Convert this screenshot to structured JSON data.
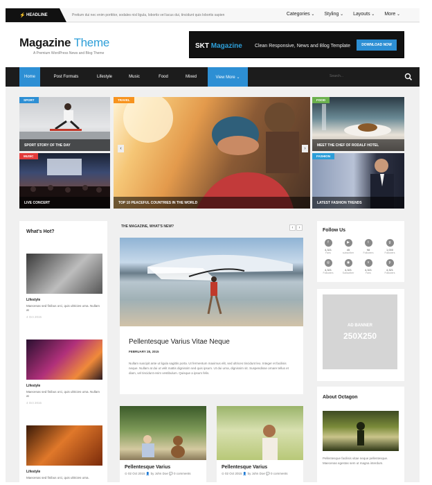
{
  "topbar": {
    "headline_label": "HEADLINE",
    "headline_text": "Pretium dui nec enim porttitor, sodales nisl ligula, lobortis vel lacus dui, tincidunt quis lobortis sapien",
    "menu": [
      "Categories",
      "Styling",
      "Layouts",
      "More"
    ]
  },
  "header": {
    "logo_main": "Magazine",
    "logo_accent": "Theme",
    "tagline": "A Premium WordPress News and Blog Theme",
    "banner_brand": "SKT",
    "banner_brand_accent": "Magazine",
    "banner_text": "Clean Responsive, News and Blog Template",
    "banner_button": "DOWNLOAD NOW"
  },
  "nav": {
    "items": [
      "Home",
      "Post Formats",
      "Lifestyle",
      "Music",
      "Food",
      "Mixed",
      "View More"
    ],
    "search_placeholder": "Search..."
  },
  "hero": {
    "tiles": [
      {
        "badge": "SPORT",
        "badge_color": "#2d8fd4",
        "caption": "SPORT STORY OF THE DAY"
      },
      {
        "badge": "MUSIC",
        "badge_color": "#e23b3b",
        "caption": "LIVE CONCERT"
      },
      {
        "badge": "TRAVEL",
        "badge_color": "#f7931e",
        "caption": "TOP 10 PEACEFUL COUNTRIES IN THE WORLD"
      },
      {
        "badge": "FOOD",
        "badge_color": "#6ab04c",
        "caption": "MEET THE CHEF OF RODALF HOTEL"
      },
      {
        "badge": "FASHION",
        "badge_color": "#2d9ed8",
        "caption": "LATEST FASHION TRENDS"
      }
    ]
  },
  "whats_hot": {
    "title": "What's Hot?",
    "posts": [
      {
        "category": "Lifestyle",
        "excerpt": "Maecenas sed finibus orci, quis ultricies urna. Nullam at",
        "date": "4 Oct 2015"
      },
      {
        "category": "Lifestyle",
        "excerpt": "Maecenas sed finibus orci, quis ultricies urna. Nullam at",
        "date": "4 Oct 2015"
      },
      {
        "category": "Lifestyle",
        "excerpt": "Maecenas sed finibus orci, quis ultricies urna.",
        "date": ""
      }
    ]
  },
  "main": {
    "section_title": "THE MAGAZINE, WHAT'S NEW?",
    "feature": {
      "title": "Pellentesque Varius Vitae Neque",
      "date": "FEBRUARY 28, 2015",
      "excerpt": "Nullam suscipit ante ut ligula sagittis porta. Ut fermentum maximus elit, sed ultrices tincidunt leo. Integer et facilisis neque. Nullam at dui ut velit mattis dignissim sed quis ipsum. Ut dui urna, dignissim sit. Suspendisse ornare tellus et diam, vel tincidunt enim vestibulum. Quisque a ipsum felis."
    },
    "small_posts": [
      {
        "title": "Pellentesque Varius",
        "meta": "⊙ 02 Oct 2015   👤 by John Doe   💬 0 comments"
      },
      {
        "title": "Pellentesque Varius",
        "meta": "⊙ 02 Oct 2015   👤 by John Doe   💬 0 comments"
      }
    ]
  },
  "follow": {
    "title": "Follow Us",
    "items": [
      {
        "n": "4,321",
        "l": "Fans"
      },
      {
        "n": "45",
        "l": "subscriber"
      },
      {
        "n": "98",
        "l": "Followers"
      },
      {
        "n": "1,000",
        "l": "Followers"
      },
      {
        "n": "4,321",
        "l": "Followers"
      },
      {
        "n": "4,321",
        "l": "Subscriber"
      },
      {
        "n": "4,321",
        "l": "Fans"
      },
      {
        "n": "4,321",
        "l": "Followers"
      }
    ]
  },
  "ad": {
    "line1": "AD BANNER",
    "line2": "250X250"
  },
  "about": {
    "title": "About Octagon",
    "text": "Pellentesque facilisis vitae neque pellentesque. Maecenas egestas sem ut magna interdum."
  }
}
